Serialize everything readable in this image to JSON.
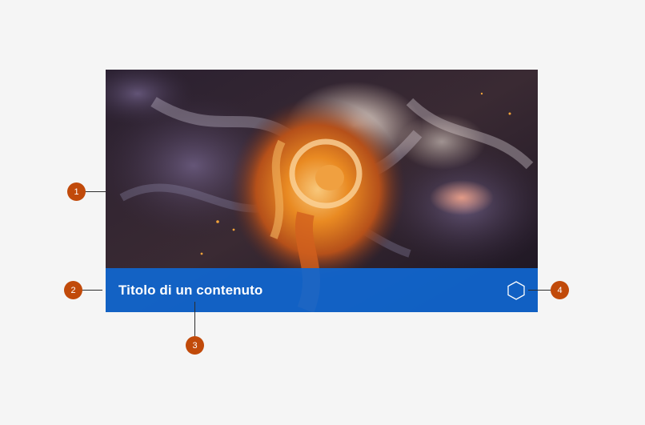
{
  "card": {
    "image_alt": "Abstract swirling fluid art with orange and white vortex",
    "title": "Titolo di un contenuto",
    "icon": "hexagon-icon",
    "caption_color": "#1066d0"
  },
  "annotations": {
    "accent_color": "#c14a0a",
    "markers": [
      "1",
      "2",
      "3",
      "4"
    ]
  }
}
